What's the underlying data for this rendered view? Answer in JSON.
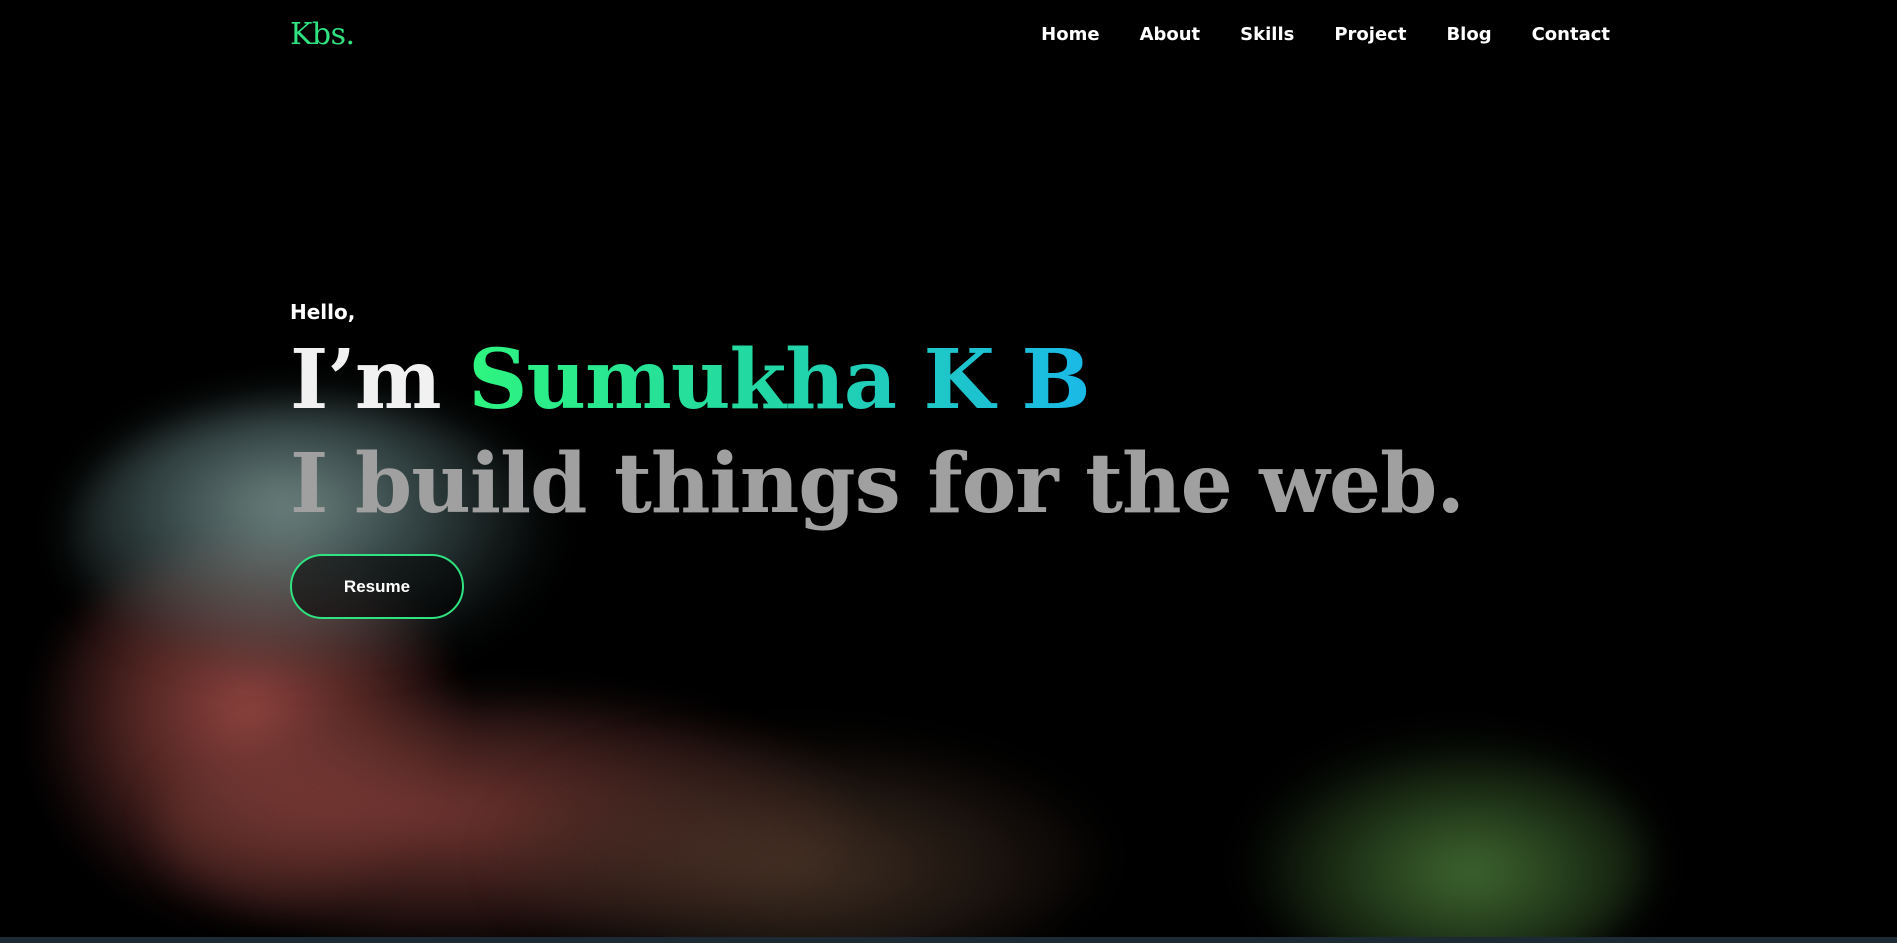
{
  "brand": {
    "logo": "Kbs.",
    "accent_color": "#2fe381"
  },
  "nav": {
    "items": [
      {
        "label": "Home"
      },
      {
        "label": "About"
      },
      {
        "label": "Skills"
      },
      {
        "label": "Project"
      },
      {
        "label": "Blog"
      },
      {
        "label": "Contact"
      }
    ]
  },
  "hero": {
    "greeting": "Hello,",
    "intro_prefix": "I’m ",
    "name": "Sumukha K B",
    "tagline": "I build things for the web.",
    "resume_label": "Resume"
  },
  "colors": {
    "background": "#000000",
    "name_gradient_start": "#2ef57f",
    "name_gradient_end": "#1ab9e8",
    "tagline": "#a0a0a0"
  }
}
